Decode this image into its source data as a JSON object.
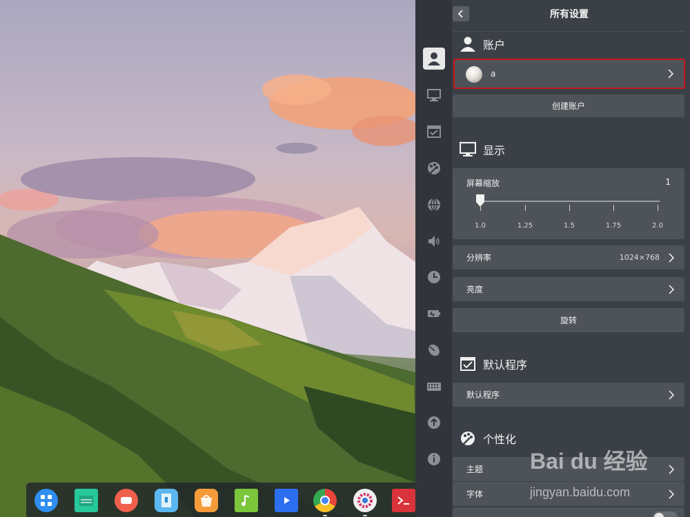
{
  "dock": {
    "apps": [
      {
        "name": "launcher-icon",
        "color": "#2f8ef0"
      },
      {
        "name": "file-manager-icon",
        "color": "#27c89b"
      },
      {
        "name": "video-recorder-icon",
        "color": "#f0604d"
      },
      {
        "name": "archive-manager-icon",
        "color": "#5bb7f0"
      },
      {
        "name": "app-store-icon",
        "color": "#f59b3a"
      },
      {
        "name": "music-icon",
        "color": "#7bc63b"
      },
      {
        "name": "movie-player-icon",
        "color": "#2b6ff0"
      },
      {
        "name": "chrome-icon",
        "color": "#e8453c"
      },
      {
        "name": "settings-icon",
        "color": "#f0f0f0"
      },
      {
        "name": "terminal-icon",
        "color": "#d9343b"
      }
    ]
  },
  "header": {
    "title": "所有设置",
    "back_icon": "chevron-left-icon"
  },
  "sidebar": {
    "items": [
      {
        "icon": "account-icon",
        "active": true
      },
      {
        "icon": "display-icon",
        "active": false
      },
      {
        "icon": "default-apps-icon",
        "active": false
      },
      {
        "icon": "personalization-icon",
        "active": false
      },
      {
        "icon": "network-icon",
        "active": false
      },
      {
        "icon": "sound-icon",
        "active": false
      },
      {
        "icon": "time-icon",
        "active": false
      },
      {
        "icon": "power-icon",
        "active": false
      },
      {
        "icon": "mouse-icon",
        "active": false
      },
      {
        "icon": "keyboard-icon",
        "active": false
      },
      {
        "icon": "update-icon",
        "active": false
      },
      {
        "icon": "info-icon",
        "active": false
      }
    ]
  },
  "account": {
    "title": "账户",
    "user_name": "a",
    "create_account": "创建账户",
    "highlight_color": "#c8141a"
  },
  "display": {
    "title": "显示",
    "scale_label": "屏幕缩放",
    "scale_value": "1",
    "scale_ticks": [
      "1.0",
      "1.25",
      "1.5",
      "1.75",
      "2.0"
    ],
    "resolution_label": "分辨率",
    "resolution_value": "1024×768",
    "brightness_label": "亮度",
    "rotate_label": "旋转"
  },
  "default_apps": {
    "title": "默认程序",
    "row_label": "默认程序"
  },
  "personalization": {
    "title": "个性化",
    "theme_label": "主题",
    "font_label": "字体"
  },
  "watermark": {
    "brand": "Bai du 经验",
    "url": "jingyan.baidu.com"
  }
}
